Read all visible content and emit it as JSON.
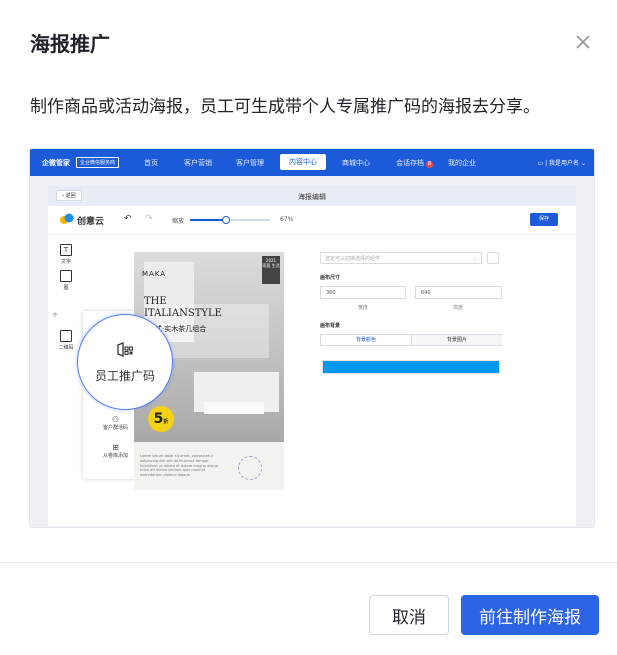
{
  "dialog": {
    "title": "海报推广",
    "description": "制作商品或活动海报，员工可生成带个人专属推广码的海报去分享。",
    "cancel_label": "取消",
    "confirm_label": "前往制作海报"
  },
  "preview": {
    "topbar": {
      "brand": "企微管家",
      "brand_tag": "企业微信服务商",
      "nav": [
        "首页",
        "客户营销",
        "客户管理",
        "内容中心",
        "商城中心",
        "会话存档",
        "我的企业"
      ],
      "active_nav": "内容中心",
      "badge": "8",
      "user": "我是用户名"
    },
    "editor": {
      "back_label": "返回",
      "title": "海报编辑",
      "logo": "创意云",
      "zoom_label": "缩放",
      "zoom_value": "67%",
      "zoom_fraction": 0.67,
      "save_label": "保存"
    },
    "tools": {
      "text_label": "文字",
      "image_label": "图",
      "extra_label": "个",
      "qr_label": "二维码"
    },
    "popup": {
      "highlight_label": "员工推广码",
      "item2": "客户群活码",
      "item3": "从卷库添加"
    },
    "poster": {
      "brand": "MAKA",
      "date": "2021",
      "date_sub": "家居 生活",
      "line1": "THE",
      "line2": "ITALIANSTYLE",
      "cn_title": "意式·实木茶几组合",
      "badge_number": "5",
      "badge_sub": "折",
      "body_text": "Lorem ipsum dolor sit amet, consectetur adipiscing elit sed do eiusmod tempor incididunt ut labore et dolore magna aliqua enim ad minim veniam quis nostrud exercitation ullamco laboris"
    },
    "props": {
      "select_placeholder": "选定可以切换选择的组件",
      "canvas_size_label": "画布尺寸",
      "width_value": "360",
      "height_value": "640",
      "width_label": "宽度",
      "height_label": "高度",
      "bg_label": "画布背景",
      "tab_color": "背景颜色",
      "tab_image": "背景图片",
      "bg_color": "#0598ee"
    }
  }
}
